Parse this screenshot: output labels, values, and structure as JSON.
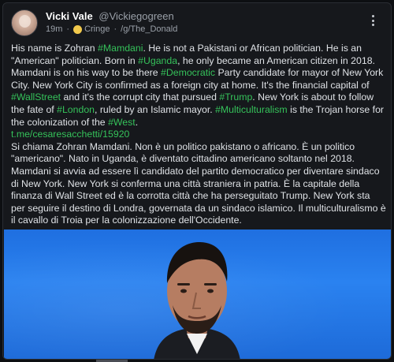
{
  "post": {
    "author_name": "Vicki Vale",
    "author_handle": "@Vickiegogreen",
    "time_ago": "19m",
    "separator": "·",
    "flair": "Cringe",
    "community": "/g/The_Donald",
    "text_en": {
      "s1": "His name is Zohran ",
      "tag1": "#Mamdani",
      "s2": ". He is not a Pakistani or African politician. He is an \"American\" politician. Born in ",
      "tag2": "#Uganda",
      "s3": ", he only became an American citizen in 2018. Mamdani is on his way to be there ",
      "tag3": "#Democratic",
      "s4": " Party candidate for mayor of New York City. New York City is confirmed as a foreign city at home. It's the financial capital of ",
      "tag4": "#WallStreet",
      "s5": " and it's the corrupt city that pursued ",
      "tag5": "#Trump",
      "s6": ". New York is about to follow the fate of ",
      "tag6": "#London",
      "s7": ", ruled by an Islamic mayor. ",
      "tag7": "#Multiculturalism",
      "s8": " is the Trojan horse for the colonization of the ",
      "tag8": "#West",
      "s9": "."
    },
    "link": "t.me/cesaresacchetti/15920",
    "text_it": "Si chiama Zohran Mamdani. Non è un politico pakistano o africano. È un politico \"americano\". Nato in Uganda, è diventato cittadino americano soltanto nel 2018. Mamdani si avvia ad essere lì candidato del partito democratico per diventare sindaco di New York. New York si conferma una città straniera in patria. È la capitale della finanza di Wall Street ed è la corrotta città che ha perseguitato Trump. New York sta per seguire il destino di Londra, governata da un sindaco islamico. Il multiculturalismo è il cavallo di Troia per la colonizzazione dell'Occidente.",
    "icons": {
      "more": "more-vertical-icon",
      "flair": "cringe-emoji-icon",
      "avatar": "avatar"
    },
    "colors": {
      "hashtag": "#35c25a",
      "background": "#16181c",
      "photo_bg": "#2a82f0"
    }
  }
}
